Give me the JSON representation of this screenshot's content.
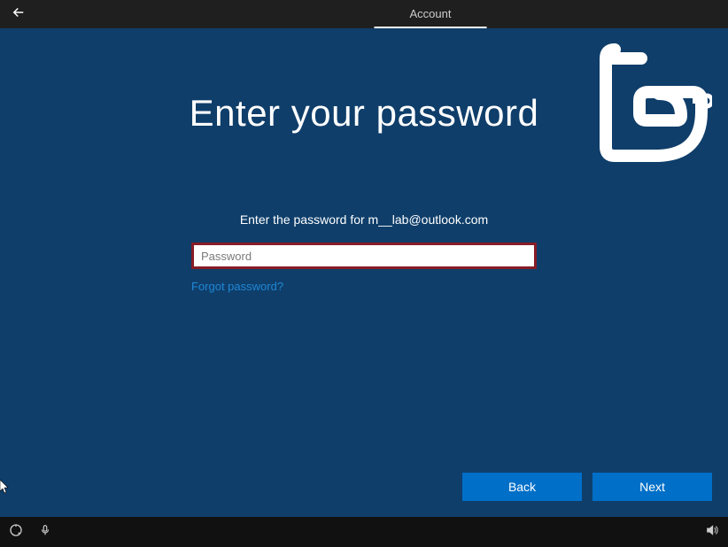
{
  "topbar": {
    "tab_label": "Account"
  },
  "main": {
    "title": "Enter your password",
    "subtitle": "Enter the password for m__lab@outlook.com",
    "password_placeholder": "Password",
    "password_value": "",
    "forgot_label": "Forgot password?"
  },
  "buttons": {
    "back": "Back",
    "next": "Next"
  },
  "tray": {
    "ease_icon": "ease-of-access-icon",
    "mic_icon": "microphone-icon",
    "volume_icon": "volume-icon"
  }
}
